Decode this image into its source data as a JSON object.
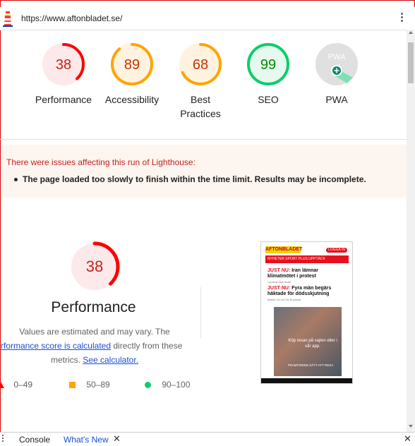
{
  "url_bar": {
    "url": "https://www.aftonbladet.se/"
  },
  "gauges": [
    {
      "key": "performance",
      "score": "38",
      "label": [
        "Performance"
      ],
      "status": "fail",
      "color": "#ff0000",
      "bg": "#fde9e9",
      "text_color": "#c5221f",
      "fraction": 0.38
    },
    {
      "key": "accessibility",
      "score": "89",
      "label": [
        "Accessibility"
      ],
      "status": "average",
      "color": "#ffa400",
      "bg": "#fff3e0",
      "text_color": "#c33300",
      "fraction": 0.89
    },
    {
      "key": "best-practices",
      "score": "68",
      "label": [
        "Best",
        "Practices"
      ],
      "status": "average",
      "color": "#ffa400",
      "bg": "#fff3e0",
      "text_color": "#c33300",
      "fraction": 0.68
    },
    {
      "key": "seo",
      "score": "99",
      "label": [
        "SEO"
      ],
      "status": "pass",
      "color": "#0cce6b",
      "bg": "#e6f9ee",
      "text_color": "#008a00",
      "fraction": 0.99
    },
    {
      "key": "pwa",
      "score": "PWA",
      "label": [
        "PWA"
      ],
      "status": "pwa",
      "color": "#9e9e9e",
      "bg": "#e0e0e0",
      "text_color": "#9e9e9e",
      "fraction": 1
    }
  ],
  "warning": {
    "title": "There were issues affecting this run of Lighthouse:",
    "items": [
      "The page loaded too slowly to finish within the time limit. Results may be incomplete."
    ]
  },
  "performance": {
    "score": "38",
    "title": "Performance",
    "desc_line1": "Values are estimated and may vary. The",
    "link_score": "performance score is calculated",
    "desc_mid": "directly from these",
    "desc_line3": "metrics.",
    "link_calc": "See calculator."
  },
  "legend": [
    {
      "range": "0–49",
      "color": "#ff0000",
      "shape": "triangle"
    },
    {
      "range": "50–89",
      "color": "#ffa400",
      "shape": "square"
    },
    {
      "range": "90–100",
      "color": "#0cce6b",
      "shape": "circle"
    }
  ],
  "thumbnail": {
    "logo": "AFTONBLADET",
    "button": "LOGGA IN",
    "nav": "NYHETER  SPORT  PLUS  UPPTÄCK",
    "h1_red": "JUST NU:",
    "h1": "Iran lämnar klimatmötet i protest",
    "h1_sub": "I protest mot Israel",
    "h2_red": "JUST NU:",
    "h2": "Fyra män begärs häktade för dödsskjutning",
    "h2_sub": "Mellan 16 och 26 år gamla",
    "ad_caption": "Köp resan på sajten eller i vår app.",
    "ad_footer": "FRAMTIDENS SÄTT ATT RESA"
  },
  "drawer": {
    "tab_console": "Console",
    "tab_whats_new": "What's New"
  },
  "icons": {
    "lighthouse": "lighthouse-icon",
    "menu": "kebab-menu-icon",
    "close": "close-icon",
    "drawer_menu": "drawer-menu-icon",
    "pwa_badge": "pwa-plus-icon"
  }
}
